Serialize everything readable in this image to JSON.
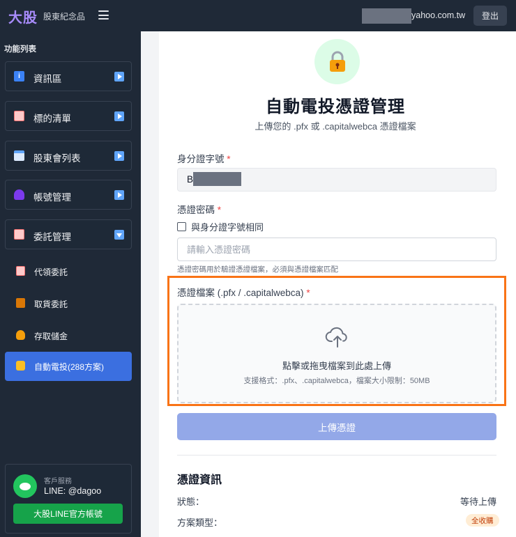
{
  "header": {
    "logo": "大股",
    "subtitle": "股東紀念品",
    "email_suffix": "yahoo.com.tw",
    "logout_label": "登出"
  },
  "sidebar": {
    "heading": "功能列表",
    "menu": [
      {
        "label": "資訊區",
        "icon": "info-icon",
        "color": "#3b82f6",
        "expanded": false
      },
      {
        "label": "標的清單",
        "icon": "clipboard-icon",
        "color": "#f87171",
        "expanded": false
      },
      {
        "label": "股東會列表",
        "icon": "calendar-icon",
        "color": "#60a5fa",
        "expanded": false
      },
      {
        "label": "帳號管理",
        "icon": "user-icon",
        "color": "#a855f7",
        "expanded": false
      },
      {
        "label": "委託管理",
        "icon": "clipboard-icon",
        "color": "#f87171",
        "expanded": true
      }
    ],
    "submenu": [
      {
        "label": "代領委託",
        "icon": "clipboard-icon"
      },
      {
        "label": "取貨委託",
        "icon": "package-icon"
      },
      {
        "label": "存取儲金",
        "icon": "money-bag-icon"
      },
      {
        "label": "自動電投(288方案)",
        "icon": "lock-icon",
        "active": true
      }
    ],
    "support": {
      "title": "客戶服務",
      "line_id": "LINE: @dagoo",
      "button_label": "大股LINE官方帳號"
    }
  },
  "main": {
    "title": "自動電投憑證管理",
    "subtitle": "上傳您的 .pfx 或 .capitalwebca 憑證檔案",
    "id_label": "身分證字號",
    "id_value": "B",
    "password_label": "憑證密碼",
    "same_as_id_label": "與身分證字號相同",
    "password_placeholder": "請輸入憑證密碼",
    "password_hint": "憑證密碼用於驗證憑證檔案，必須與憑證檔案匹配",
    "file_label": "憑證檔案 (.pfx / .capitalwebca)",
    "required_mark": "*",
    "dropzone_main": "點擊或拖曳檔案到此處上傳",
    "dropzone_sub": "支援格式：.pfx、.capitalwebca，檔案大小限制：50MB",
    "upload_button": "上傳憑證",
    "info_title": "憑證資訊",
    "status_key": "狀態：",
    "status_value": "等待上傳",
    "plan_key": "方案類型：",
    "plan_badge": "全收購"
  },
  "colors": {
    "accent": "#3b6fe0",
    "highlight": "#f97316",
    "line_green": "#16a34a"
  }
}
